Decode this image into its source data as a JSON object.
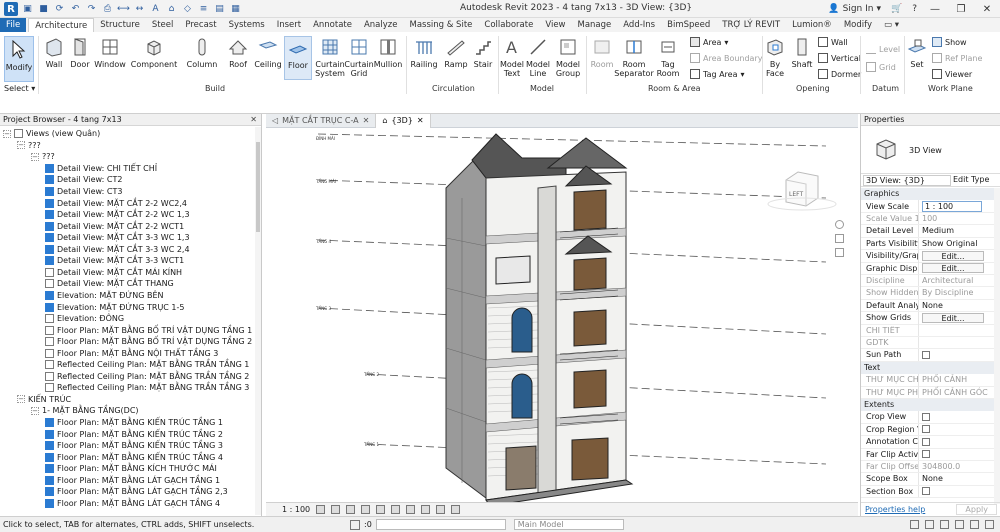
{
  "app": {
    "title": "Autodesk Revit 2023 - 4 tang 7x13 - 3D View: {3D}",
    "logo": "R",
    "sign_in": "Sign In"
  },
  "tabs": [
    "File",
    "Architecture",
    "Structure",
    "Steel",
    "Precast",
    "Systems",
    "Insert",
    "Annotate",
    "Analyze",
    "Massing & Site",
    "Collaborate",
    "View",
    "Manage",
    "Add-Ins",
    "BimSpeed",
    "TRỢ LÝ REVIT",
    "Lumion®",
    "Modify"
  ],
  "ribbon": {
    "modify": "Modify",
    "select": "Select ▾",
    "build": {
      "label": "Build",
      "items": [
        "Wall",
        "Door",
        "Window",
        "Component",
        "Column",
        "Roof",
        "Ceiling",
        "Floor",
        "Curtain\nSystem",
        "Curtain\nGrid",
        "Mullion"
      ]
    },
    "circulation": {
      "label": "Circulation",
      "items": [
        "Railing",
        "Ramp",
        "Stair"
      ]
    },
    "model": {
      "label": "Model",
      "items": [
        "Model\nText",
        "Model\nLine",
        "Model\nGroup"
      ]
    },
    "room_area": {
      "label": "Room & Area",
      "items": [
        "Room",
        "Room\nSeparator",
        "Tag\nRoom"
      ],
      "small": [
        "Area",
        "Area  Boundary",
        "Tag  Area"
      ]
    },
    "opening": {
      "label": "Opening",
      "items": [
        "By\nFace",
        "Shaft"
      ],
      "small": [
        "Wall",
        "Vertical",
        "Dormer"
      ]
    },
    "datum": {
      "label": "Datum",
      "small": [
        "Level",
        "Grid"
      ]
    },
    "work_plane": {
      "label": "Work Plane",
      "items": [
        "Set"
      ],
      "small": [
        "Show",
        "Ref  Plane",
        "Viewer"
      ]
    }
  },
  "browser": {
    "title": "Project Browser - 4 tang 7x13",
    "nodes": [
      {
        "t": "Views (view Quân)",
        "lvl": 0,
        "type": "root"
      },
      {
        "t": "???",
        "lvl": 1,
        "type": "group"
      },
      {
        "t": "???",
        "lvl": 2,
        "type": "group"
      },
      {
        "t": "Detail View: CHI TIẾT CHỈ",
        "lvl": 3,
        "type": "view"
      },
      {
        "t": "Detail View: CT2",
        "lvl": 3,
        "type": "view"
      },
      {
        "t": "Detail View: CT3",
        "lvl": 3,
        "type": "view"
      },
      {
        "t": "Detail View: MẶT CẮT 2-2 WC2,4",
        "lvl": 3,
        "type": "view"
      },
      {
        "t": "Detail View: MẶT CẮT 2-2 WC 1,3",
        "lvl": 3,
        "type": "view"
      },
      {
        "t": "Detail View: MẶT CẮT 2-2 WCT1",
        "lvl": 3,
        "type": "view"
      },
      {
        "t": "Detail View: MẶT CẮT 3-3 WC 1,3",
        "lvl": 3,
        "type": "view"
      },
      {
        "t": "Detail View: MẶT CẮT 3-3 WC 2,4",
        "lvl": 3,
        "type": "view"
      },
      {
        "t": "Detail View: MẶT CẮT 3-3 WCT1",
        "lvl": 3,
        "type": "view"
      },
      {
        "t": "Detail View: MẶT CẮT MÁI KÍNH",
        "lvl": 3,
        "type": "plain"
      },
      {
        "t": "Detail View: MẶT CẮT THANG",
        "lvl": 3,
        "type": "plain"
      },
      {
        "t": "Elevation: MẶT ĐỨNG BÊN",
        "lvl": 3,
        "type": "view"
      },
      {
        "t": "Elevation: MẶT ĐỨNG TRỤC 1-5",
        "lvl": 3,
        "type": "view"
      },
      {
        "t": "Elevation: ĐÔNG",
        "lvl": 3,
        "type": "plain"
      },
      {
        "t": "Floor Plan: MẶT BẰNG BỐ TRÍ VẬT DỤNG TẦNG 1",
        "lvl": 3,
        "type": "plain"
      },
      {
        "t": "Floor Plan: MẶT BẰNG BỐ TRÍ VẬT DỤNG TẦNG 2",
        "lvl": 3,
        "type": "plain"
      },
      {
        "t": "Floor Plan: MẶT BẰNG NỘI THẤT TẦNG 3",
        "lvl": 3,
        "type": "plain"
      },
      {
        "t": "Reflected Ceiling Plan: MẶT BẰNG TRẦN TẦNG 1",
        "lvl": 3,
        "type": "plain"
      },
      {
        "t": "Reflected Ceiling Plan: MẶT BẰNG TRẦN TẦNG 2",
        "lvl": 3,
        "type": "plain"
      },
      {
        "t": "Reflected Ceiling Plan: MẶT BẰNG TRẦN TẦNG 3",
        "lvl": 3,
        "type": "plain"
      },
      {
        "t": "KIẾN TRÚC",
        "lvl": 1,
        "type": "group"
      },
      {
        "t": "1- MẶT BẰNG TẦNG(DC)",
        "lvl": 2,
        "type": "group"
      },
      {
        "t": "Floor Plan: MẶT BẰNG KIẾN TRÚC TẦNG 1",
        "lvl": 3,
        "type": "view"
      },
      {
        "t": "Floor Plan: MẶT BẰNG KIẾN TRÚC TẦNG 2",
        "lvl": 3,
        "type": "view"
      },
      {
        "t": "Floor Plan: MẶT BẰNG KIẾN TRÚC TẦNG 3",
        "lvl": 3,
        "type": "view"
      },
      {
        "t": "Floor Plan: MẶT BẰNG KIẾN TRÚC TẦNG 4",
        "lvl": 3,
        "type": "view"
      },
      {
        "t": "Floor Plan: MẶT BẰNG KÍCH THƯỚC MÁI",
        "lvl": 3,
        "type": "view"
      },
      {
        "t": "Floor Plan: MẶT BẰNG LÁT GẠCH TẦNG 1",
        "lvl": 3,
        "type": "view"
      },
      {
        "t": "Floor Plan: MẶT BẰNG LÁT GẠCH TẦNG 2,3",
        "lvl": 3,
        "type": "view"
      },
      {
        "t": "Floor Plan: MẶT BẰNG LÁT GẠCH TẦNG 4",
        "lvl": 3,
        "type": "view"
      }
    ]
  },
  "view": {
    "tabs": [
      {
        "label": "MẶT CẮT TRỤC C-A",
        "active": false
      },
      {
        "label": "{3D}",
        "active": true
      }
    ],
    "cube_label": "LEFT",
    "levels": [
      "ĐỈNH MÁI",
      "TẦNG MÁI",
      "TẦNG 4",
      "TẦNG 3",
      "TẦNG 2",
      "TẦNG 1"
    ],
    "scale": "1 : 100"
  },
  "properties": {
    "title": "Properties",
    "type_name": "3D View",
    "instance": "3D View: {3D}",
    "edit_type": "Edit Type",
    "rows": [
      {
        "cat": "Graphics"
      },
      {
        "k": "View Scale",
        "v": "1 : 100",
        "input": true
      },
      {
        "k": "Scale Value   1:",
        "v": "100",
        "dim": true
      },
      {
        "k": "Detail Level",
        "v": "Medium"
      },
      {
        "k": "Parts Visibility",
        "v": "Show Original"
      },
      {
        "k": "Visibility/Grap...",
        "v": "Edit...",
        "btn": true
      },
      {
        "k": "Graphic Displ...",
        "v": "Edit...",
        "btn": true
      },
      {
        "k": "Discipline",
        "v": "Architectural",
        "dim": true
      },
      {
        "k": "Show Hidden ...",
        "v": "By Discipline",
        "dim": true
      },
      {
        "k": "Default Analys...",
        "v": "None"
      },
      {
        "k": "Show Grids",
        "v": "Edit...",
        "btn": true
      },
      {
        "k": "CHI TIẾT",
        "v": "",
        "dim": true
      },
      {
        "k": "GDTK",
        "v": "",
        "dim": true
      },
      {
        "k": "Sun Path",
        "v": "",
        "chk": true
      },
      {
        "cat": "Text"
      },
      {
        "k": "THƯ MỤC CHÍ...",
        "v": "PHỐI CẢNH",
        "dim": true
      },
      {
        "k": "THƯ MỤC PHỤ",
        "v": "PHỐI CẢNH GÓC",
        "dim": true
      },
      {
        "cat": "Extents"
      },
      {
        "k": "Crop View",
        "v": "",
        "chk": true
      },
      {
        "k": "Crop Region V...",
        "v": "",
        "chk": true
      },
      {
        "k": "Annotation Cr...",
        "v": "",
        "chk": true
      },
      {
        "k": "Far Clip Active",
        "v": "",
        "chk": true
      },
      {
        "k": "Far Clip Offset",
        "v": "304800.0",
        "dim": true
      },
      {
        "k": "Scope Box",
        "v": "None"
      },
      {
        "k": "Section Box",
        "v": "",
        "chk": true
      }
    ],
    "help": "Properties help",
    "apply": "Apply"
  },
  "status": {
    "text": "Click to select, TAB for alternates, CTRL adds, SHIFT unselects.",
    "model": "Main Model",
    "counter": ":0"
  }
}
